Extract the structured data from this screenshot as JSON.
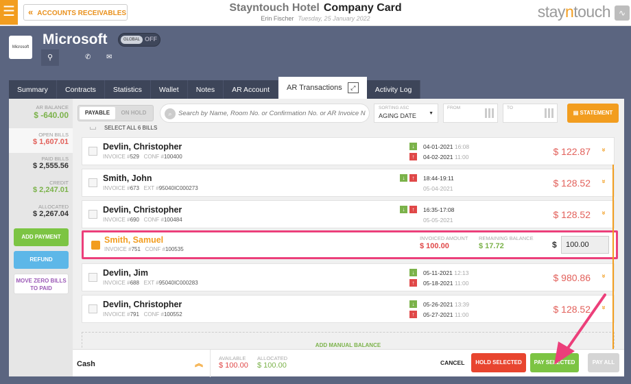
{
  "header": {
    "back_label": "ACCOUNTS RECEIVABLES",
    "hotel": "Stayntouch Hotel",
    "page_title": "Company Card",
    "user": "Erin Fischer",
    "date": "Tuesday, 25 January 2022",
    "brand_a": "stay",
    "brand_n": "n",
    "brand_b": "touch"
  },
  "account": {
    "logo_text": "Microsoft",
    "name": "Microsoft",
    "global_toggle": "GLOBAL",
    "global_state": "OFF"
  },
  "tabs": [
    {
      "label": "Summary"
    },
    {
      "label": "Contracts"
    },
    {
      "label": "Statistics"
    },
    {
      "label": "Wallet"
    },
    {
      "label": "Notes"
    },
    {
      "label": "AR Account"
    },
    {
      "label": "AR Transactions",
      "active": true
    },
    {
      "label": "Activity Log"
    }
  ],
  "sidebar": {
    "ar_balance_label": "AR BALANCE",
    "ar_balance": "$ -640.00",
    "open_bills_label": "OPEN BILLS",
    "open_bills": "$ 1,607.01",
    "paid_bills_label": "PAID BILLS",
    "paid_bills": "$ 2,555.56",
    "credit_label": "CREDIT",
    "credit": "$ 2,247.01",
    "allocated_label": "ALLOCATED",
    "allocated": "$ 2,267.04",
    "add_payment": "ADD PAYMENT",
    "refund": "REFUND",
    "move_zero": "MOVE ZERO BILLS TO PAID"
  },
  "filters": {
    "payable": "PAYABLE",
    "on_hold": "ON HOLD",
    "search_placeholder": "Search by Name, Room No. or Confirmation No. or AR Invoice N",
    "sort_label": "SORTING ASC",
    "sort_value": "AGING DATE",
    "from_label": "FROM",
    "to_label": "TO",
    "statement": "STATEMENT"
  },
  "select_all": "SELECT ALL 6 BILLS",
  "bills": [
    {
      "name": "Devlin, Christopher",
      "invoice": "529",
      "ref_label": "CONF #",
      "ref": "100400",
      "d1": "04-01-2021",
      "t1": "16:08",
      "d2": "04-02-2021",
      "t2": "11:00",
      "amount": "$ 122.87"
    },
    {
      "name": "Smith, John",
      "invoice": "673",
      "ref_label": "EXT #",
      "ref": "95040IC000273",
      "d1": "18:44-19:11",
      "t1": "",
      "d2": "05-04-2021",
      "t2": "",
      "amount": "$ 128.52"
    },
    {
      "name": "Devlin, Christopher",
      "invoice": "690",
      "ref_label": "CONF #",
      "ref": "100484",
      "d1": "16:35-17:08",
      "t1": "",
      "d2": "05-05-2021",
      "t2": "",
      "amount": "$ 128.52"
    },
    {
      "name": "Smith, Samuel",
      "invoice": "751",
      "ref_label": "CONF #",
      "ref": "100535",
      "invoiced_label": "INVOICED AMOUNT",
      "invoiced": "$ 100.00",
      "remaining_label": "REMAINING BALANCE",
      "remaining": "$ 17.72",
      "currency": "$",
      "pay_value": "100.00"
    },
    {
      "name": "Devlin, Jim",
      "invoice": "688",
      "ref_label": "EXT #",
      "ref": "95040IC000283",
      "d1": "05-11-2021",
      "t1": "12:13",
      "d2": "05-18-2021",
      "t2": "11:00",
      "amount": "$ 980.86"
    },
    {
      "name": "Devlin, Christopher",
      "invoice": "791",
      "ref_label": "CONF #",
      "ref": "100552",
      "d1": "05-26-2021",
      "t1": "13:39",
      "d2": "05-27-2021",
      "t2": "11:00",
      "amount": "$ 128.52"
    }
  ],
  "invoice_label": "INVOICE #",
  "manual_balance": "ADD MANUAL BALANCE",
  "footer": {
    "method": "Cash",
    "available_label": "AVAILABLE",
    "available": "$ 100.00",
    "allocated_label": "ALLOCATED",
    "allocated": "$ 100.00",
    "cancel": "CANCEL",
    "hold_selected": "HOLD SELECTED",
    "pay_selected": "PAY SELECTED",
    "pay_all": "PAY ALL"
  },
  "colors": {
    "accent": "#f29d1f",
    "highlight_border": "#ec3f7a",
    "amount_red": "#e2605a",
    "green": "#7bb24a",
    "hold_red": "#e8452f",
    "pay_green": "#7cc443"
  }
}
